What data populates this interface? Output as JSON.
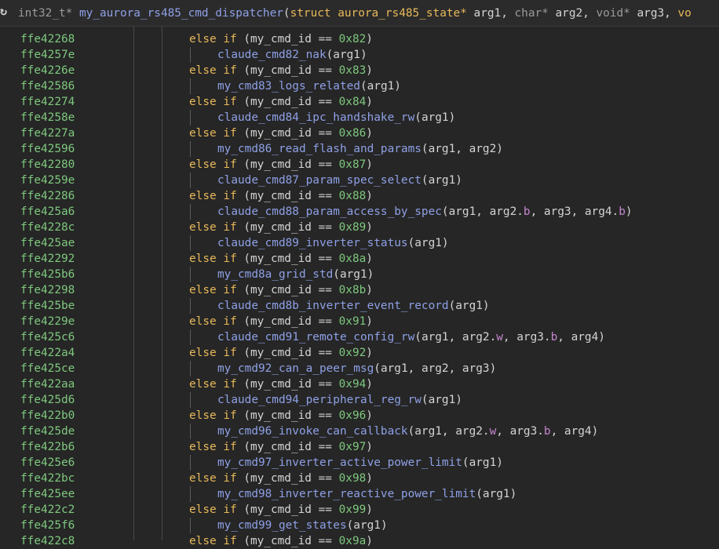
{
  "header": {
    "icon": "refresh-icon",
    "return_type": "int32_t*",
    "function_name": "my_aurora_rs485_cmd_dispatcher",
    "p1_kw": "struct",
    "p1_type": "aurora_rs485_state*",
    "p1_name": "arg1",
    "p2_type": "char*",
    "p2_name": "arg2",
    "p3_type": "void*",
    "p3_name": "arg3",
    "p4_type": "vo"
  },
  "rows": [
    {
      "addr": "ffe42268",
      "kind": "cond",
      "id": "0x82"
    },
    {
      "addr": "ffe4257e",
      "kind": "call",
      "fn": "claude_cmd82_nak",
      "args": [
        {
          "a": "arg1"
        }
      ]
    },
    {
      "addr": "ffe4226e",
      "kind": "cond",
      "id": "0x83"
    },
    {
      "addr": "ffe42586",
      "kind": "call",
      "fn": "my_cmd83_logs_related",
      "args": [
        {
          "a": "arg1"
        }
      ]
    },
    {
      "addr": "ffe42274",
      "kind": "cond",
      "id": "0x84"
    },
    {
      "addr": "ffe4258e",
      "kind": "call",
      "fn": "claude_cmd84_ipc_handshake_rw",
      "args": [
        {
          "a": "arg1"
        }
      ]
    },
    {
      "addr": "ffe4227a",
      "kind": "cond",
      "id": "0x86"
    },
    {
      "addr": "ffe42596",
      "kind": "call",
      "fn": "my_cmd86_read_flash_and_params",
      "args": [
        {
          "a": "arg1"
        },
        {
          "a": "arg2"
        }
      ]
    },
    {
      "addr": "ffe42280",
      "kind": "cond",
      "id": "0x87"
    },
    {
      "addr": "ffe4259e",
      "kind": "call",
      "fn": "claude_cmd87_param_spec_select",
      "args": [
        {
          "a": "arg1"
        }
      ]
    },
    {
      "addr": "ffe42286",
      "kind": "cond",
      "id": "0x88"
    },
    {
      "addr": "ffe425a6",
      "kind": "call",
      "fn": "claude_cmd88_param_access_by_spec",
      "args": [
        {
          "a": "arg1"
        },
        {
          "a": "arg2",
          "f": "b"
        },
        {
          "a": "arg3"
        },
        {
          "a": "arg4",
          "f": "b"
        }
      ]
    },
    {
      "addr": "ffe4228c",
      "kind": "cond",
      "id": "0x89"
    },
    {
      "addr": "ffe425ae",
      "kind": "call",
      "fn": "claude_cmd89_inverter_status",
      "args": [
        {
          "a": "arg1"
        }
      ]
    },
    {
      "addr": "ffe42292",
      "kind": "cond",
      "id": "0x8a"
    },
    {
      "addr": "ffe425b6",
      "kind": "call",
      "fn": "my_cmd8a_grid_std",
      "args": [
        {
          "a": "arg1"
        }
      ]
    },
    {
      "addr": "ffe42298",
      "kind": "cond",
      "id": "0x8b"
    },
    {
      "addr": "ffe425be",
      "kind": "call",
      "fn": "claude_cmd8b_inverter_event_record",
      "args": [
        {
          "a": "arg1"
        }
      ]
    },
    {
      "addr": "ffe4229e",
      "kind": "cond",
      "id": "0x91"
    },
    {
      "addr": "ffe425c6",
      "kind": "call",
      "fn": "claude_cmd91_remote_config_rw",
      "args": [
        {
          "a": "arg1"
        },
        {
          "a": "arg2",
          "f": "w"
        },
        {
          "a": "arg3",
          "f": "b"
        },
        {
          "a": "arg4"
        }
      ]
    },
    {
      "addr": "ffe422a4",
      "kind": "cond",
      "id": "0x92"
    },
    {
      "addr": "ffe425ce",
      "kind": "call",
      "fn": "my_cmd92_can_a_peer_msg",
      "args": [
        {
          "a": "arg1"
        },
        {
          "a": "arg2"
        },
        {
          "a": "arg3"
        }
      ]
    },
    {
      "addr": "ffe422aa",
      "kind": "cond",
      "id": "0x94"
    },
    {
      "addr": "ffe425d6",
      "kind": "call",
      "fn": "claude_cmd94_peripheral_reg_rw",
      "args": [
        {
          "a": "arg1"
        }
      ]
    },
    {
      "addr": "ffe422b0",
      "kind": "cond",
      "id": "0x96"
    },
    {
      "addr": "ffe425de",
      "kind": "call",
      "fn": "my_cmd96_invoke_can_callback",
      "args": [
        {
          "a": "arg1"
        },
        {
          "a": "arg2",
          "f": "w"
        },
        {
          "a": "arg3",
          "f": "b"
        },
        {
          "a": "arg4"
        }
      ]
    },
    {
      "addr": "ffe422b6",
      "kind": "cond",
      "id": "0x97"
    },
    {
      "addr": "ffe425e6",
      "kind": "call",
      "fn": "my_cmd97_inverter_active_power_limit",
      "args": [
        {
          "a": "arg1"
        }
      ]
    },
    {
      "addr": "ffe422bc",
      "kind": "cond",
      "id": "0x98"
    },
    {
      "addr": "ffe425ee",
      "kind": "call",
      "fn": "my_cmd98_inverter_reactive_power_limit",
      "args": [
        {
          "a": "arg1"
        }
      ]
    },
    {
      "addr": "ffe422c2",
      "kind": "cond",
      "id": "0x99"
    },
    {
      "addr": "ffe425f6",
      "kind": "call",
      "fn": "my_cmd99_get_states",
      "args": [
        {
          "a": "arg1"
        }
      ]
    },
    {
      "addr": "ffe422c8",
      "kind": "cond",
      "id": "0x9a"
    }
  ],
  "tokens": {
    "else_if": "else if",
    "cmd_var": "my_cmd_id",
    "eq": "=="
  }
}
